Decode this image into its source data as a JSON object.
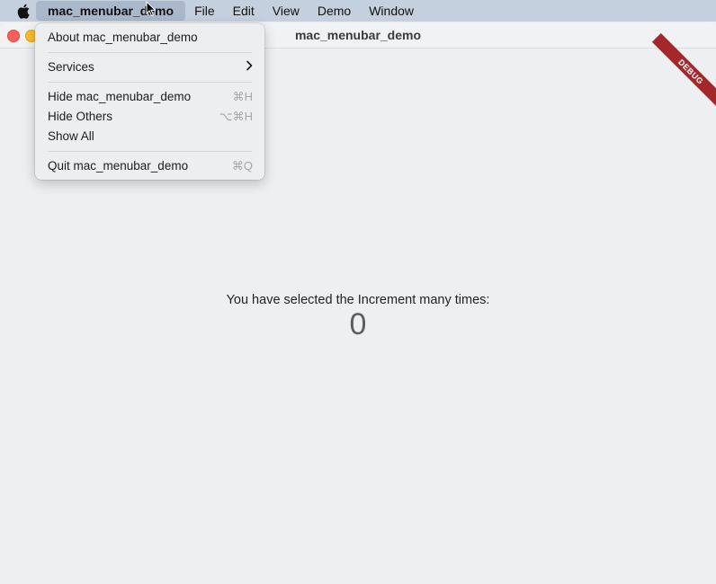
{
  "menubar": {
    "app_name": "mac_menubar_demo",
    "items": [
      "File",
      "Edit",
      "View",
      "Demo",
      "Window"
    ]
  },
  "window": {
    "title": "mac_menubar_demo",
    "debug_banner": "DEBUG"
  },
  "app_menu": {
    "about": "About mac_menubar_demo",
    "services": "Services",
    "hide": "Hide mac_menubar_demo",
    "hide_shortcut": "⌘H",
    "hide_others": "Hide Others",
    "hide_others_shortcut": "⌥⌘H",
    "show_all": "Show All",
    "quit": "Quit mac_menubar_demo",
    "quit_shortcut": "⌘Q"
  },
  "content": {
    "label": "You have selected the Increment many times:",
    "count": "0"
  },
  "colors": {
    "close": "#ff5f57",
    "minimize": "#febc2e",
    "debug_banner": "#a3282b",
    "menubar": "#c4d0de"
  }
}
